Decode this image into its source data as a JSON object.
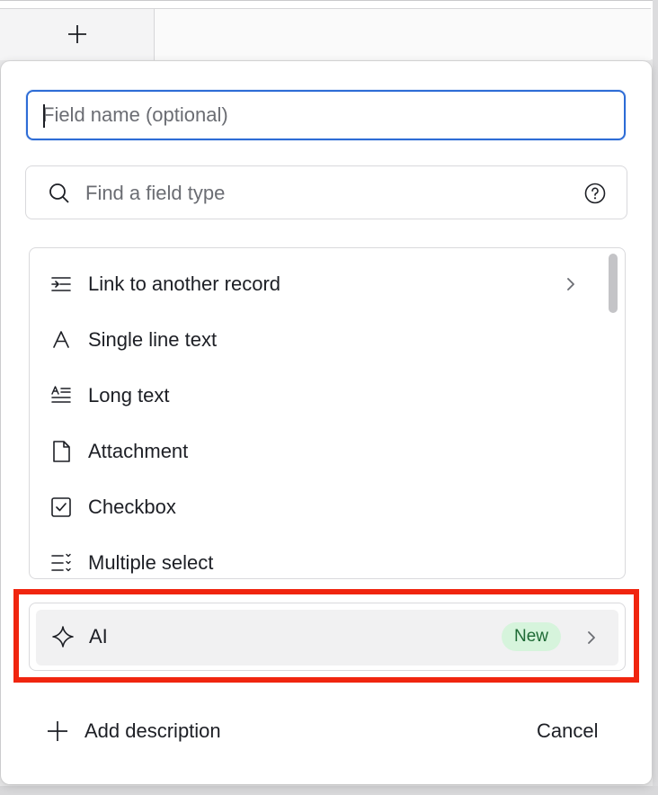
{
  "field_name": {
    "placeholder": "Field name (optional)",
    "value": ""
  },
  "search": {
    "placeholder": "Find a field type"
  },
  "field_types": [
    {
      "label": "Link to another record",
      "icon": "link-record-icon",
      "has_submenu": true
    },
    {
      "label": "Single line text",
      "icon": "single-line-text-icon",
      "has_submenu": false
    },
    {
      "label": "Long text",
      "icon": "long-text-icon",
      "has_submenu": false
    },
    {
      "label": "Attachment",
      "icon": "attachment-icon",
      "has_submenu": false
    },
    {
      "label": "Checkbox",
      "icon": "checkbox-icon",
      "has_submenu": false
    },
    {
      "label": "Multiple select",
      "icon": "multiple-select-icon",
      "has_submenu": false
    }
  ],
  "ai_option": {
    "label": "AI",
    "badge": "New",
    "icon": "sparkle-icon"
  },
  "footer": {
    "add_description": "Add description",
    "cancel": "Cancel"
  },
  "colors": {
    "focus_border": "#2d6cd6",
    "badge_bg": "#d6f4dc",
    "badge_text": "#1e6a35",
    "highlight": "#f0250f"
  }
}
